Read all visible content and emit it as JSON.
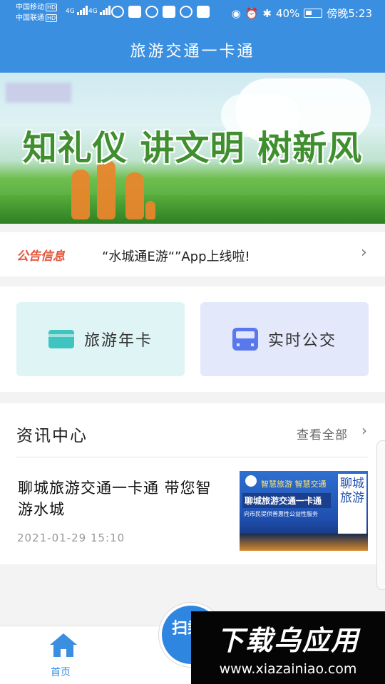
{
  "status_bar": {
    "carrier_1": "中国移动",
    "carrier_2": "中国联通",
    "hd": "HD",
    "net_1": "4G",
    "net_2": "4G",
    "battery": "40%",
    "time": "傍晚5:23"
  },
  "header": {
    "title": "旅游交通一卡通"
  },
  "banner": {
    "slogan": "知礼仪 讲文明 树新风"
  },
  "notice": {
    "tag": "公告信息",
    "text": "“水城通E游“”App上线啦!"
  },
  "quick_actions": [
    {
      "label": "旅游年卡",
      "icon": "card-icon"
    },
    {
      "label": "实时公交",
      "icon": "bus-icon"
    }
  ],
  "news": {
    "section_title": "资讯中心",
    "view_all": "查看全部",
    "items": [
      {
        "headline": "聊城旅游交通一卡通 带您智游水城",
        "date": "2021-01-29 15:10",
        "thumb": {
          "top_text": "智慧旅游  智慧交通",
          "main_text": "聊城旅游交通一卡通",
          "sub_text": "向市民提供普惠性公益性服务",
          "side_text": "聊城旅游"
        }
      }
    ]
  },
  "bottom_nav": {
    "home_label": "首页",
    "scan_label": "扫乘"
  },
  "watermark": {
    "title": "下载乌应用",
    "url": "www.xiazainiao.com"
  },
  "colors": {
    "brand": "#3b8fe0",
    "notice_tag": "#e5553a",
    "card_1_bg": "#dff4f4",
    "card_2_bg": "#e3e8fb"
  }
}
